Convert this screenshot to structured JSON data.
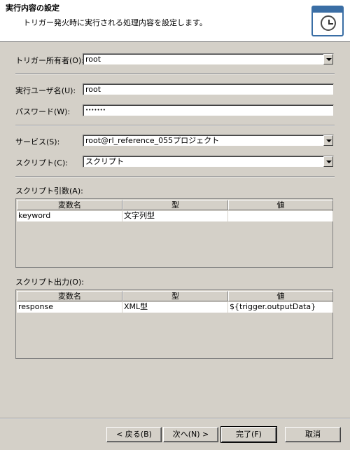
{
  "header": {
    "title": "実行内容の設定",
    "description": "トリガー発火時に実行される処理内容を設定します。"
  },
  "trigger_owner": {
    "label": "トリガー所有者(O):",
    "value": "root"
  },
  "exec_user": {
    "label": "実行ユーザ名(U):",
    "value": "root"
  },
  "password": {
    "label": "パスワード(W):",
    "value": "•••••••"
  },
  "service": {
    "label": "サービス(S):",
    "value": "root@rl_reference_055プロジェクト"
  },
  "script": {
    "label": "スクリプト(C):",
    "value": "スクリプト"
  },
  "script_args": {
    "label": "スクリプト引数(A):",
    "columns": [
      "変数名",
      "型",
      "値"
    ],
    "rows": [
      {
        "name": "keyword",
        "type": "文字列型",
        "value": ""
      }
    ]
  },
  "script_output": {
    "label": "スクリプト出力(O):",
    "columns": [
      "変数名",
      "型",
      "値"
    ],
    "rows": [
      {
        "name": "response",
        "type": "XML型",
        "value": "${trigger.outputData}"
      }
    ]
  },
  "buttons": {
    "back": "< 戻る(B)",
    "next": "次へ(N) >",
    "finish": "完了(F)",
    "cancel": "取消"
  },
  "icon": "clock-window-icon"
}
